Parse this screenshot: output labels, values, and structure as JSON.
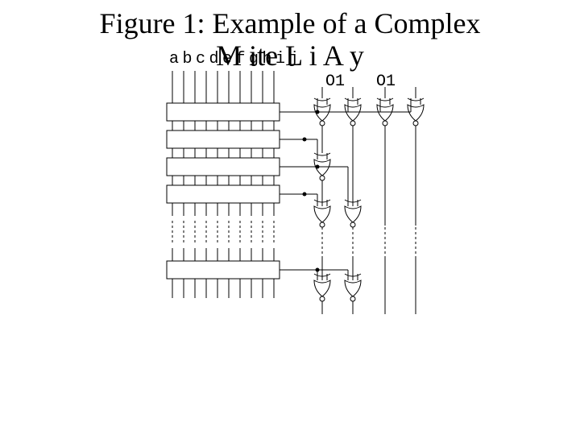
{
  "title_line1": "Figure 1: Example of a Complex",
  "title_line2": "M ite  L  i  A       y",
  "column_labels": "abcdefghij",
  "output_groups": [
    {
      "label": "O1",
      "index": 0
    },
    {
      "label": "O1",
      "index": 1
    }
  ],
  "diagram": {
    "num_inputs": 10,
    "num_rows_top": 4,
    "gap_rows": true,
    "num_rows_bottom": 1,
    "gate_type": "xnor",
    "outputs_per_group": 2
  }
}
